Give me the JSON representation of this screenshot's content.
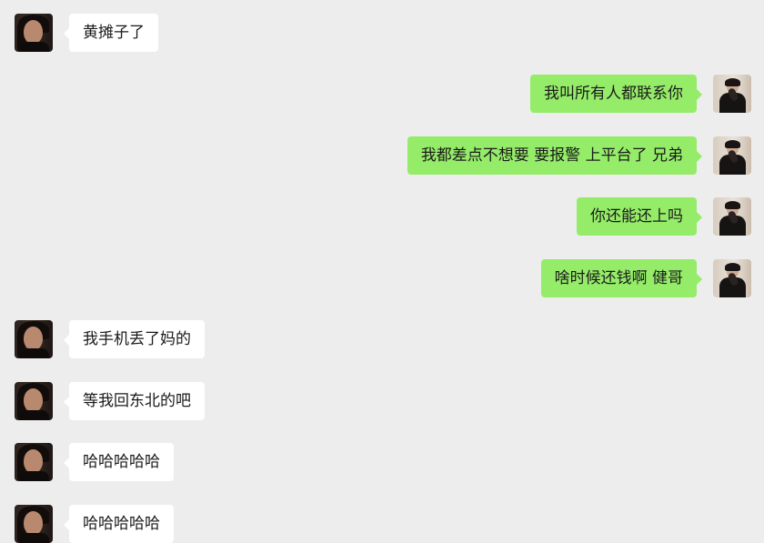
{
  "colors": {
    "background": "#ededed",
    "incoming_bubble": "#ffffff",
    "outgoing_bubble": "#95ec69",
    "text": "#1a1a1a"
  },
  "avatars": {
    "contact": "contact-avatar-photo",
    "me": "self-avatar-photo"
  },
  "messages": [
    {
      "side": "left",
      "text": "黄摊子了"
    },
    {
      "side": "right",
      "text": "我叫所有人都联系你"
    },
    {
      "side": "right",
      "text": "我都差点不想要 要报警 上平台了 兄弟"
    },
    {
      "side": "right",
      "text": "你还能还上吗"
    },
    {
      "side": "right",
      "text": "啥时候还钱啊 健哥"
    },
    {
      "side": "left",
      "text": "我手机丢了妈的"
    },
    {
      "side": "left",
      "text": "等我回东北的吧"
    },
    {
      "side": "left",
      "text": "哈哈哈哈哈"
    },
    {
      "side": "left",
      "text": "哈哈哈哈哈"
    }
  ]
}
